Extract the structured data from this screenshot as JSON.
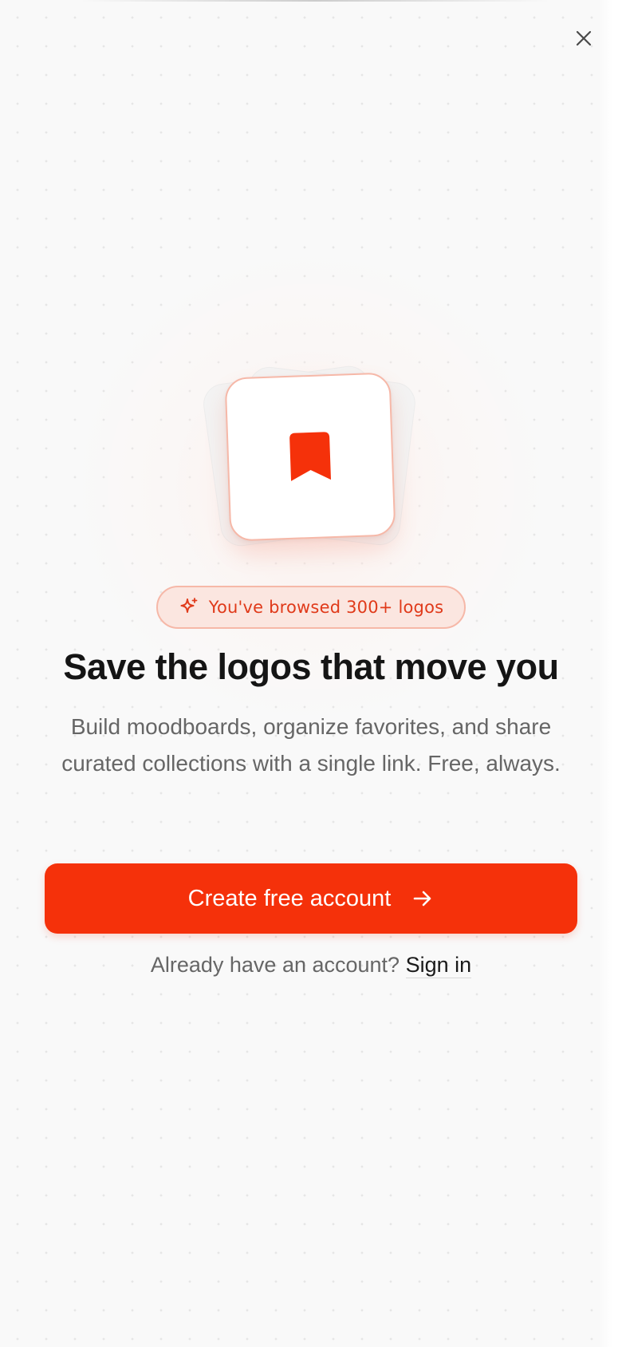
{
  "modal": {
    "close_icon": "close-icon",
    "hero_icon": "bookmark-icon",
    "badge": {
      "icon": "sparkle-icon",
      "text": "You've browsed 300+ logos"
    },
    "headline": "Save the logos that move you",
    "description": "Build moodboards, organize favorites, and share curated collections with a single link. Free, always.",
    "cta": {
      "label": "Create free account",
      "icon": "arrow-right-icon"
    },
    "signin": {
      "prompt": "Already have an account?",
      "link_label": "Sign in"
    }
  },
  "colors": {
    "accent": "#f5310a",
    "badge_background": "#fbe6e0",
    "badge_border": "#f6b8a8",
    "headline": "#151515",
    "body_text": "#666666",
    "background": "#f9f9f9"
  }
}
